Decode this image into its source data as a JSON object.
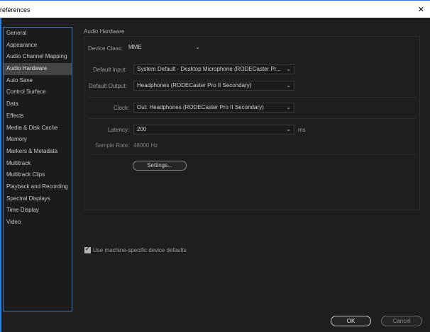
{
  "window": {
    "title": "references",
    "close_glyph": "✕"
  },
  "sidebar": {
    "items": [
      {
        "label": "General"
      },
      {
        "label": "Appearance"
      },
      {
        "label": "Audio Channel Mapping"
      },
      {
        "label": "Audio Hardware",
        "selected": true
      },
      {
        "label": "Auto Save"
      },
      {
        "label": "Control Surface"
      },
      {
        "label": "Data"
      },
      {
        "label": "Effects"
      },
      {
        "label": "Media & Disk Cache"
      },
      {
        "label": "Memory"
      },
      {
        "label": "Markers & Metadata"
      },
      {
        "label": "Multitrack"
      },
      {
        "label": "Multitrack Clips"
      },
      {
        "label": "Playback and Recording"
      },
      {
        "label": "Spectral Displays"
      },
      {
        "label": "Time Display"
      },
      {
        "label": "Video"
      }
    ]
  },
  "audio_hardware": {
    "section_title": "Audio Hardware",
    "device_class": {
      "label": "Device Class:",
      "value": "MME"
    },
    "default_input": {
      "label": "Default Input:",
      "value": "System Default - Desktop Microphone (RODECaster Pr..."
    },
    "default_output": {
      "label": "Default Output:",
      "value": "Headphones (RODECaster Pro II Secondary)"
    },
    "clock": {
      "label": "Clock:",
      "value": "Out: Headphones (RODECaster Pro II Secondary)"
    },
    "latency": {
      "label": "Latency:",
      "value": "200",
      "unit": "ms"
    },
    "sample_rate": {
      "label": "Sample Rate:",
      "value": "48000 Hz"
    },
    "settings_button": "Settings..."
  },
  "machine_defaults": {
    "label": "Use machine-specific device defaults",
    "checked": true
  },
  "footer": {
    "ok_label": "OK",
    "cancel_label": "Cancel"
  },
  "icons": {
    "chevron": "chevron-down-icon",
    "check": "checkmark-icon"
  }
}
